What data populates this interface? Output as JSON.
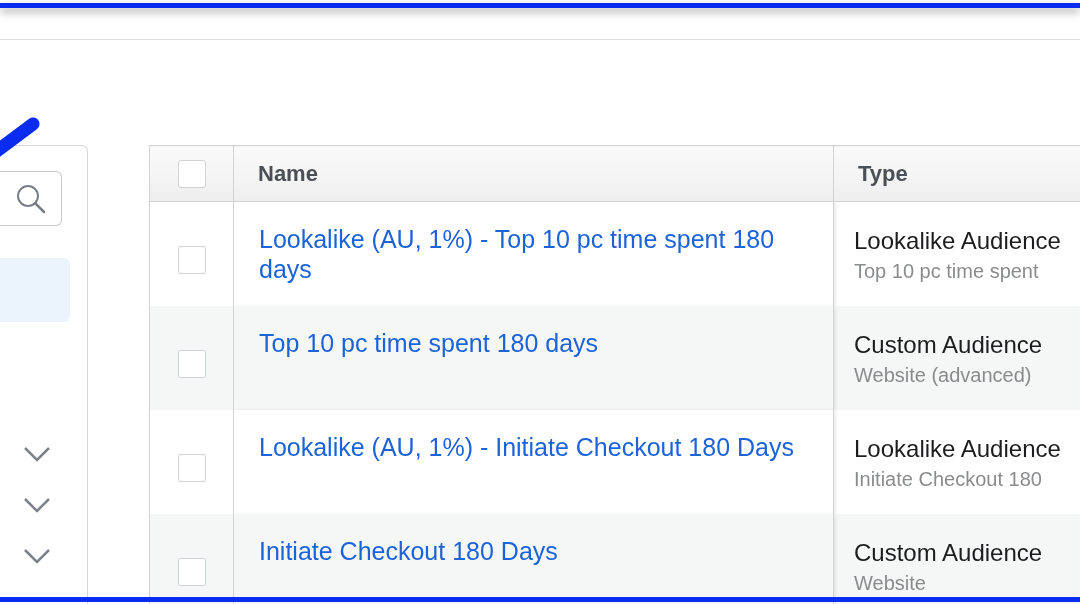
{
  "sidebar": {
    "sections": [
      {
        "expanded": false
      },
      {
        "expanded": false
      },
      {
        "expanded": false
      }
    ]
  },
  "table": {
    "columns": [
      "Name",
      "Type"
    ],
    "header_checkbox": {
      "checked": false
    },
    "rows": [
      {
        "checked": false,
        "name": "Lookalike (AU, 1%) - Top 10 pc time spent 180 days",
        "type": "Lookalike Audience",
        "source": "Top 10 pc time spent"
      },
      {
        "checked": false,
        "name": "Top 10 pc time spent 180 days",
        "type": "Custom Audience",
        "source": "Website (advanced)"
      },
      {
        "checked": false,
        "name": "Lookalike (AU, 1%) - Initiate Checkout 180 Days",
        "type": "Lookalike Audience",
        "source": "Initiate Checkout 180"
      },
      {
        "checked": false,
        "name": "Initiate Checkout 180 Days",
        "type": "Custom Audience",
        "source": "Website"
      }
    ]
  }
}
